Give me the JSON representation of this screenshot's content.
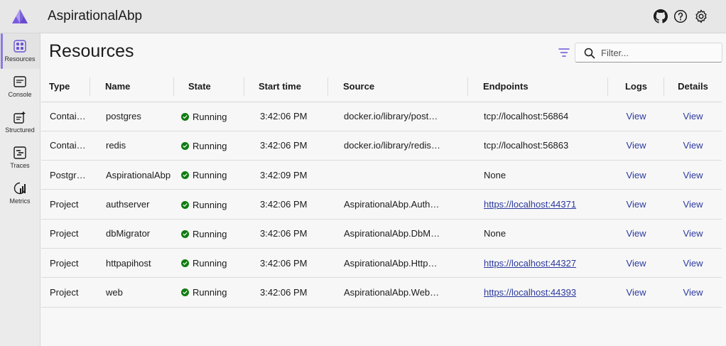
{
  "app": {
    "title": "AspirationalAbp"
  },
  "colors": {
    "accent": "#8b7ae0",
    "running": "#107c10",
    "link": "#2b3a9e"
  },
  "header_icons": [
    "github-icon",
    "help-icon",
    "settings-icon"
  ],
  "sidebar": {
    "items": [
      {
        "label": "Resources",
        "icon": "resources-icon",
        "active": true
      },
      {
        "label": "Console",
        "icon": "console-icon"
      },
      {
        "label": "Structured",
        "icon": "structured-icon"
      },
      {
        "label": "Traces",
        "icon": "traces-icon"
      },
      {
        "label": "Metrics",
        "icon": "metrics-icon"
      }
    ]
  },
  "page": {
    "title": "Resources"
  },
  "search": {
    "placeholder": "Filter..."
  },
  "table": {
    "columns": [
      "Type",
      "Name",
      "State",
      "Start time",
      "Source",
      "Endpoints",
      "Logs",
      "Details"
    ],
    "rows": [
      {
        "type": "Contai…",
        "name": "postgres",
        "state": "Running",
        "start": "3:42:06 PM",
        "source": "docker.io/library/post…",
        "endpoint": "tcp://localhost:56864",
        "endpoint_link": false,
        "logs": "View",
        "details": "View"
      },
      {
        "type": "Contai…",
        "name": "redis",
        "state": "Running",
        "start": "3:42:06 PM",
        "source": "docker.io/library/redis…",
        "endpoint": "tcp://localhost:56863",
        "endpoint_link": false,
        "logs": "View",
        "details": "View"
      },
      {
        "type": "Postgr…",
        "name": "AspirationalAbp",
        "state": "Running",
        "start": "3:42:09 PM",
        "source": "",
        "endpoint": "None",
        "endpoint_link": false,
        "logs": "View",
        "details": "View"
      },
      {
        "type": "Project",
        "name": "authserver",
        "state": "Running",
        "start": "3:42:06 PM",
        "source": "AspirationalAbp.Auth…",
        "endpoint": "https://localhost:44371",
        "endpoint_link": true,
        "logs": "View",
        "details": "View"
      },
      {
        "type": "Project",
        "name": "dbMigrator",
        "state": "Running",
        "start": "3:42:06 PM",
        "source": "AspirationalAbp.DbM…",
        "endpoint": "None",
        "endpoint_link": false,
        "logs": "View",
        "details": "View"
      },
      {
        "type": "Project",
        "name": "httpapihost",
        "state": "Running",
        "start": "3:42:06 PM",
        "source": "AspirationalAbp.Http…",
        "endpoint": "https://localhost:44327",
        "endpoint_link": true,
        "logs": "View",
        "details": "View"
      },
      {
        "type": "Project",
        "name": "web",
        "state": "Running",
        "start": "3:42:06 PM",
        "source": "AspirationalAbp.Web…",
        "endpoint": "https://localhost:44393",
        "endpoint_link": true,
        "logs": "View",
        "details": "View"
      }
    ]
  }
}
